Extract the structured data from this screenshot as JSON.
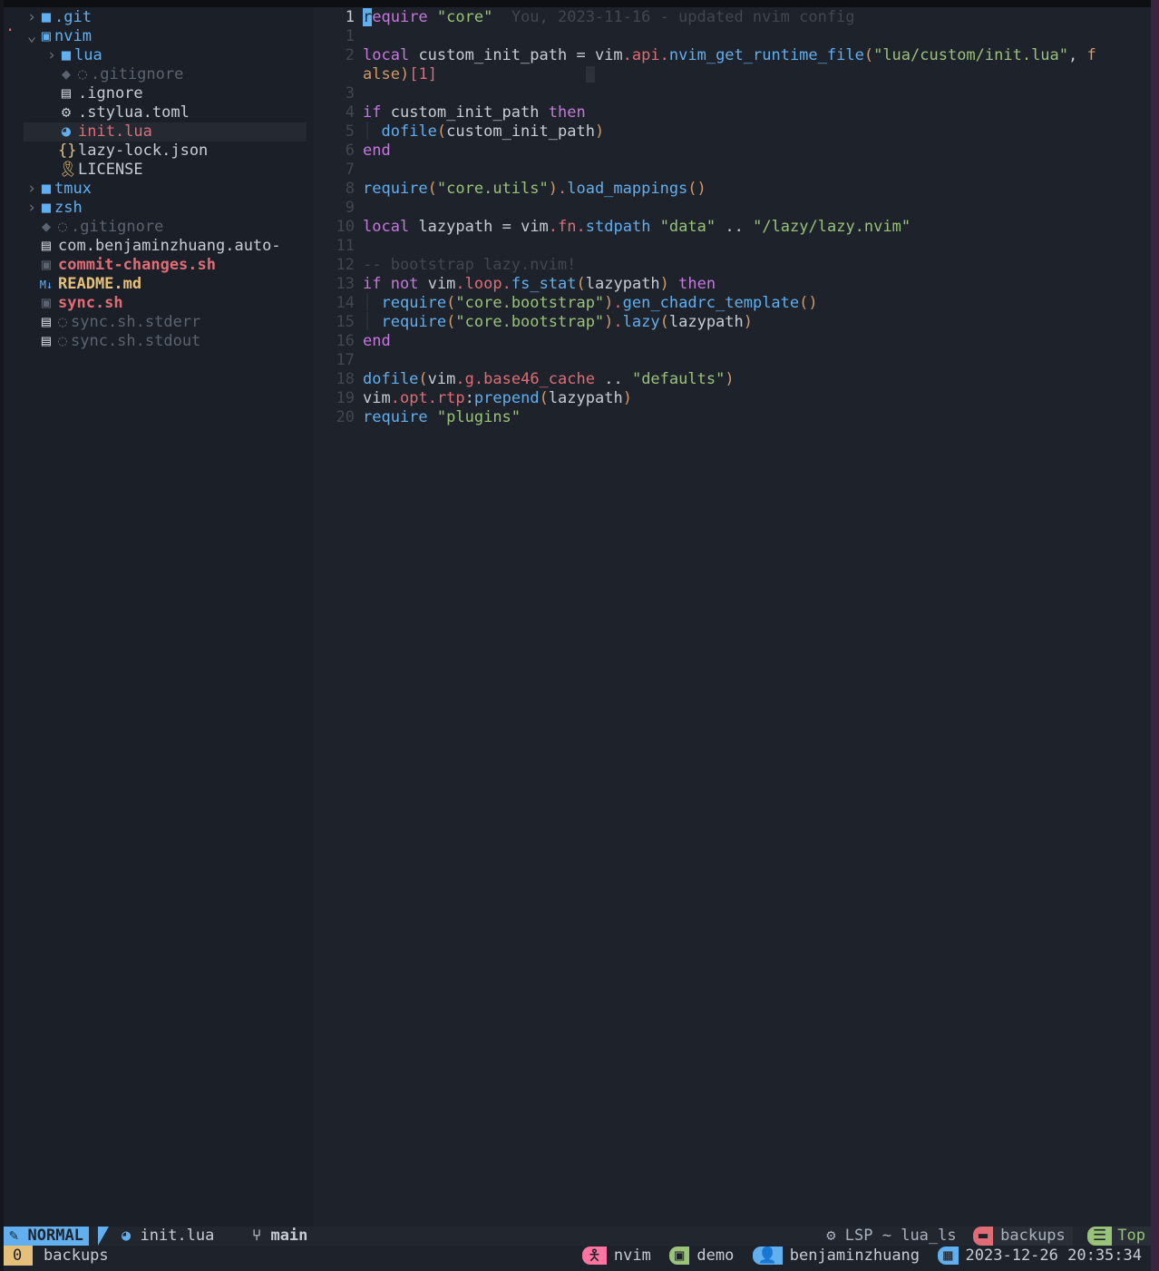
{
  "file_tree": {
    "items": [
      {
        "name": ".git",
        "type": "folder",
        "depth": 0,
        "state": "collapsed"
      },
      {
        "name": "nvim",
        "type": "folder",
        "depth": 0,
        "state": "expanded"
      },
      {
        "name": "lua",
        "type": "folder",
        "depth": 1,
        "state": "collapsed"
      },
      {
        "name": ".gitignore",
        "type": "file",
        "depth": 1,
        "style": "ignored"
      },
      {
        "name": ".ignore",
        "type": "file",
        "depth": 1
      },
      {
        "name": ".stylua.toml",
        "type": "file",
        "depth": 1
      },
      {
        "name": "init.lua",
        "type": "file",
        "depth": 1,
        "style": "modified",
        "selected": true
      },
      {
        "name": "lazy-lock.json",
        "type": "file",
        "depth": 1
      },
      {
        "name": "LICENSE",
        "type": "file",
        "depth": 1
      },
      {
        "name": "tmux",
        "type": "folder",
        "depth": 0,
        "state": "collapsed"
      },
      {
        "name": "zsh",
        "type": "folder",
        "depth": 0,
        "state": "collapsed"
      },
      {
        "name": ".gitignore",
        "type": "file",
        "depth": 0,
        "style": "ignored"
      },
      {
        "name": "com.benjaminzhuang.auto-",
        "type": "file",
        "depth": 0
      },
      {
        "name": "commit-changes.sh",
        "type": "file",
        "depth": 0,
        "style": "modified"
      },
      {
        "name": "README.md",
        "type": "file",
        "depth": 0,
        "style": "special"
      },
      {
        "name": "sync.sh",
        "type": "file",
        "depth": 0,
        "style": "modified"
      },
      {
        "name": "sync.sh.stderr",
        "type": "file",
        "depth": 0,
        "style": "ignored"
      },
      {
        "name": "sync.sh.stdout",
        "type": "file",
        "depth": 0,
        "style": "ignored"
      }
    ]
  },
  "editor": {
    "line_numbers": [
      "1",
      "1",
      "2",
      "",
      "3",
      "4",
      "5",
      "6",
      "7",
      "8",
      "9",
      "10",
      "11",
      "12",
      "13",
      "14",
      "15",
      "16",
      "17",
      "18",
      "19",
      "20"
    ],
    "blame": "You, 2023-11-16 - updated nvim config",
    "lines": {
      "l0_a": "r",
      "l0_b": "equire",
      "l0_c": "\"core\"",
      "l2_a": "local",
      "l2_b": "custom_init_path",
      "l2_c": "=",
      "l2_d": "vim",
      "l2_e": "api",
      "l2_f": "nvim_get_runtime_file",
      "l2_g": "\"lua/custom/init.lua\"",
      "l2_h": "f",
      "l3_a": "alse",
      "l3_b": "1",
      "l5_a": "if",
      "l5_b": "custom_init_path",
      "l5_c": "then",
      "l6_a": "dofile",
      "l6_b": "custom_init_path",
      "l7_a": "end",
      "l9_a": "require",
      "l9_b": "\"core.utils\"",
      "l9_c": "load_mappings",
      "l11_a": "local",
      "l11_b": "lazypath",
      "l11_c": "vim",
      "l11_d": "fn",
      "l11_e": "stdpath",
      "l11_f": "\"data\"",
      "l11_g": "\"/lazy/lazy.nvim\"",
      "l13_a": "-- bootstrap lazy.nvim!",
      "l14_a": "if",
      "l14_b": "not",
      "l14_c": "vim",
      "l14_d": "loop",
      "l14_e": "fs_stat",
      "l14_f": "lazypath",
      "l14_g": "then",
      "l15_a": "require",
      "l15_b": "\"core.bootstrap\"",
      "l15_c": "gen_chadrc_template",
      "l16_a": "require",
      "l16_b": "\"core.bootstrap\"",
      "l16_c": "lazy",
      "l16_d": "lazypath",
      "l17_a": "end",
      "l19_a": "dofile",
      "l19_b": "vim",
      "l19_c": "g",
      "l19_d": "base46_cache",
      "l19_e": "\"defaults\"",
      "l20_a": "vim",
      "l20_b": "opt",
      "l20_c": "rtp",
      "l20_d": "prepend",
      "l20_e": "lazypath",
      "l21_a": "require",
      "l21_b": "\"plugins\""
    }
  },
  "statusline": {
    "mode": "NORMAL",
    "file": "init.lua",
    "branch": "main",
    "lsp": "LSP ~ lua_ls",
    "cwd": "backups",
    "position": "Top"
  },
  "tmux": {
    "window_index": "0",
    "window_name": "backups",
    "process": "nvim",
    "session": "demo",
    "user": "benjaminzhuang",
    "datetime": "2023-12-26 20:35:34"
  },
  "colors": {
    "background": "#1e222a",
    "sidebar": "#1b1f27",
    "accent_blue": "#61afef",
    "accent_red": "#e06c75",
    "accent_yellow": "#e5c07b",
    "accent_green": "#98c379",
    "accent_purple": "#c678dd",
    "pink": "#ff75a0"
  }
}
